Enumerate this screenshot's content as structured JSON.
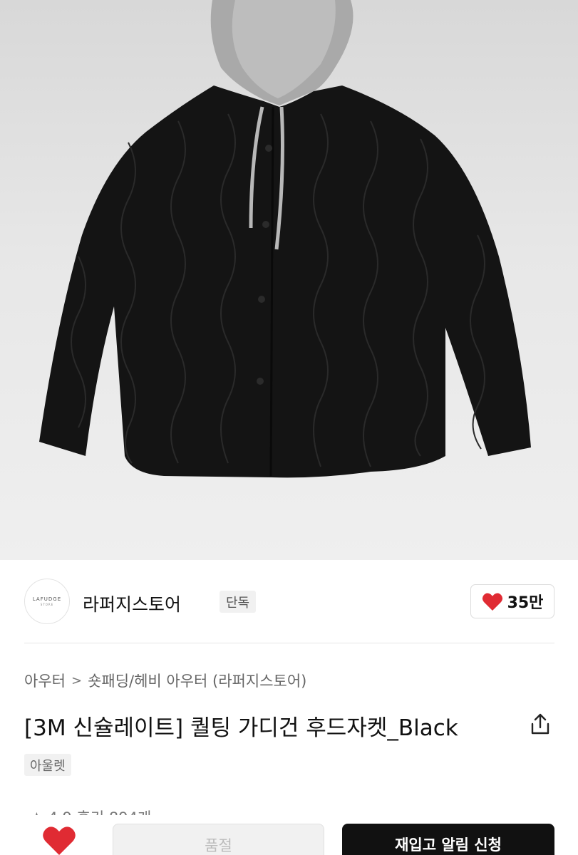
{
  "product_image": {
    "alt": ""
  },
  "store": {
    "logo_text": "LAFUDGE",
    "logo_subtext": "STORE",
    "name": "라퍼지스토어",
    "badge": "단독",
    "likes": "35만"
  },
  "breadcrumb": {
    "category": "아우터",
    "separator": ">",
    "subcategory": "숏패딩/헤비 아우터 (라퍼지스토어)"
  },
  "product": {
    "title": "[3M 신슐레이트] 퀄팅 가디건 후드자켓_Black",
    "tag": "아울렛",
    "rating_partial": "★ 4.9  후기 894개"
  },
  "bottom_bar": {
    "secondary_label": "품절",
    "primary_label": "재입고 알림 신청"
  },
  "colors": {
    "heart": "#e02b33",
    "primary_button": "#111111",
    "secondary_button": "#f1f1f1"
  }
}
